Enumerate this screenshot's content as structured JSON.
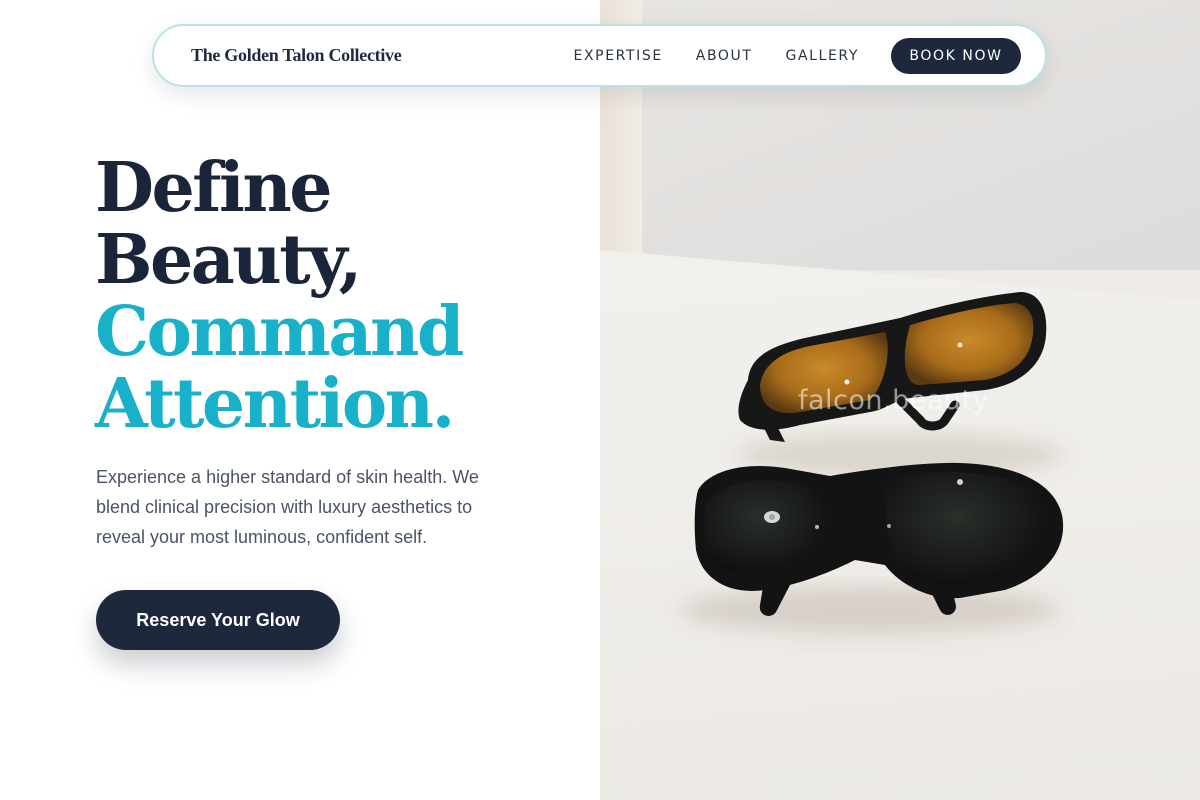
{
  "brand": {
    "name": "The Golden Talon Collective"
  },
  "nav": {
    "links": [
      "EXPERTISE",
      "ABOUT",
      "GALLERY"
    ],
    "book_label": "BOOK NOW"
  },
  "hero": {
    "title_line1": "Define",
    "title_line2": "Beauty,",
    "title_accent_line1": "Command",
    "title_accent_line2": "Attention.",
    "description": "Experience a higher standard of skin health. We blend clinical precision with luxury aesthetics to reveal your most luminous, confident self.",
    "cta_label": "Reserve Your Glow"
  },
  "photo": {
    "watermark": "falcon.beauty"
  },
  "colors": {
    "navy": "#1e283c",
    "accent": "#18b1c9",
    "nav_border": "#b8e2e8"
  }
}
